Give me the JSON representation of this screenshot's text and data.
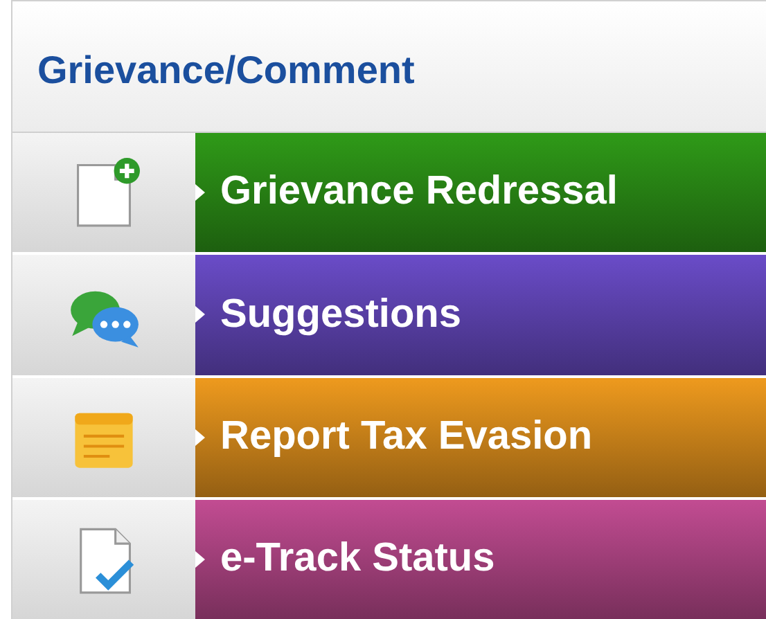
{
  "title": "Grievance/Comment",
  "items": [
    {
      "label": "Grievance Redressal",
      "kind": "add-document",
      "color": "#2f9a18"
    },
    {
      "label": "Suggestions",
      "kind": "chat",
      "color": "#6a4cc8"
    },
    {
      "label": "Report Tax Evasion",
      "kind": "note",
      "color": "#ee9a1e"
    },
    {
      "label": "e-Track Status",
      "kind": "check-document",
      "color": "#c24c92"
    }
  ]
}
